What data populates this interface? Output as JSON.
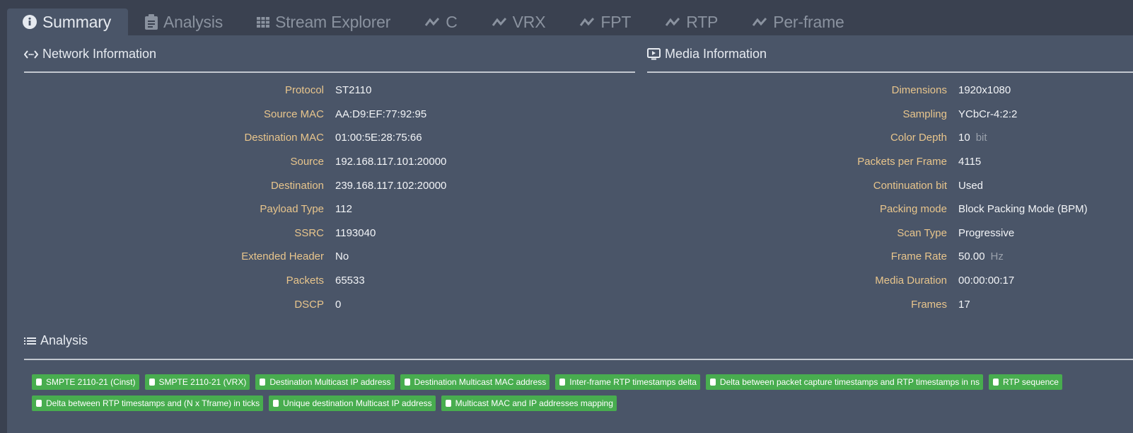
{
  "tabs": [
    {
      "label": "Summary",
      "icon": "info-icon",
      "active": true
    },
    {
      "label": "Analysis",
      "icon": "clipboard-icon",
      "active": false
    },
    {
      "label": "Stream Explorer",
      "icon": "grid-icon",
      "active": false
    },
    {
      "label": "C",
      "icon": "line-chart-icon",
      "active": false
    },
    {
      "label": "VRX",
      "icon": "line-chart-icon",
      "active": false
    },
    {
      "label": "FPT",
      "icon": "line-chart-icon",
      "active": false
    },
    {
      "label": "RTP",
      "icon": "line-chart-icon",
      "active": false
    },
    {
      "label": "Per-frame",
      "icon": "line-chart-icon",
      "active": false
    }
  ],
  "network": {
    "title": "Network Information",
    "rows": [
      {
        "key": "Protocol",
        "value": "ST2110"
      },
      {
        "key": "Source MAC",
        "value": "AA:D9:EF:77:92:95"
      },
      {
        "key": "Destination MAC",
        "value": "01:00:5E:28:75:66"
      },
      {
        "key": "Source",
        "value": "192.168.117.101:20000"
      },
      {
        "key": "Destination",
        "value": "239.168.117.102:20000"
      },
      {
        "key": "Payload Type",
        "value": "112"
      },
      {
        "key": "SSRC",
        "value": "1193040"
      },
      {
        "key": "Extended Header",
        "value": "No"
      },
      {
        "key": "Packets",
        "value": "65533"
      },
      {
        "key": "DSCP",
        "value": "0"
      }
    ]
  },
  "media": {
    "title": "Media Information",
    "rows": [
      {
        "key": "Dimensions",
        "value": "1920x1080",
        "unit": ""
      },
      {
        "key": "Sampling",
        "value": "YCbCr-4:2:2",
        "unit": ""
      },
      {
        "key": "Color Depth",
        "value": "10",
        "unit": "bit"
      },
      {
        "key": "Packets per Frame",
        "value": "4115",
        "unit": ""
      },
      {
        "key": "Continuation bit",
        "value": "Used",
        "unit": ""
      },
      {
        "key": "Packing mode",
        "value": "Block Packing Mode (BPM)",
        "unit": ""
      },
      {
        "key": "Scan Type",
        "value": "Progressive",
        "unit": ""
      },
      {
        "key": "Frame Rate",
        "value": "50.00",
        "unit": "Hz"
      },
      {
        "key": "Media Duration",
        "value": "00:00:00:17",
        "unit": ""
      },
      {
        "key": "Frames",
        "value": "17",
        "unit": ""
      }
    ]
  },
  "analysis": {
    "title": "Analysis",
    "badge_color": "#48ad4f",
    "badges_row1": [
      "SMPTE 2110-21 (Cinst)",
      "SMPTE 2110-21 (VRX)",
      "Destination Multicast IP address",
      "Destination Multicast MAC address",
      "Inter-frame RTP timestamps delta",
      "Delta between packet capture timestamps and RTP timestamps in ns",
      "RTP sequence"
    ],
    "badges_row2": [
      "Delta between RTP timestamps and (N x Tframe) in ticks",
      "Unique destination Multicast IP address",
      "Multicast MAC and IP addresses mapping"
    ]
  }
}
